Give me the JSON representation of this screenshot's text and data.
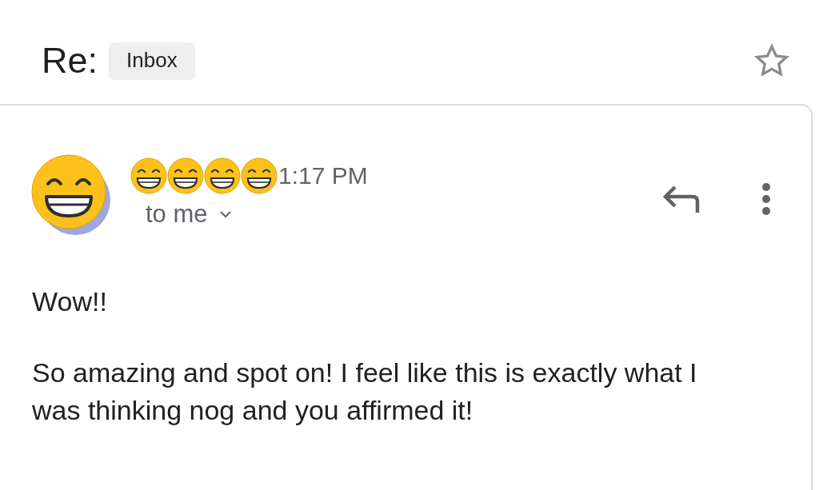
{
  "subject": "Re:",
  "label": "Inbox",
  "starred": false,
  "message": {
    "time": "1:17 PM",
    "recipient": "to me",
    "body": [
      "Wow!!",
      "So amazing and spot on! I feel like this is exactly what I was thinking nog and you affirmed it!"
    ]
  }
}
